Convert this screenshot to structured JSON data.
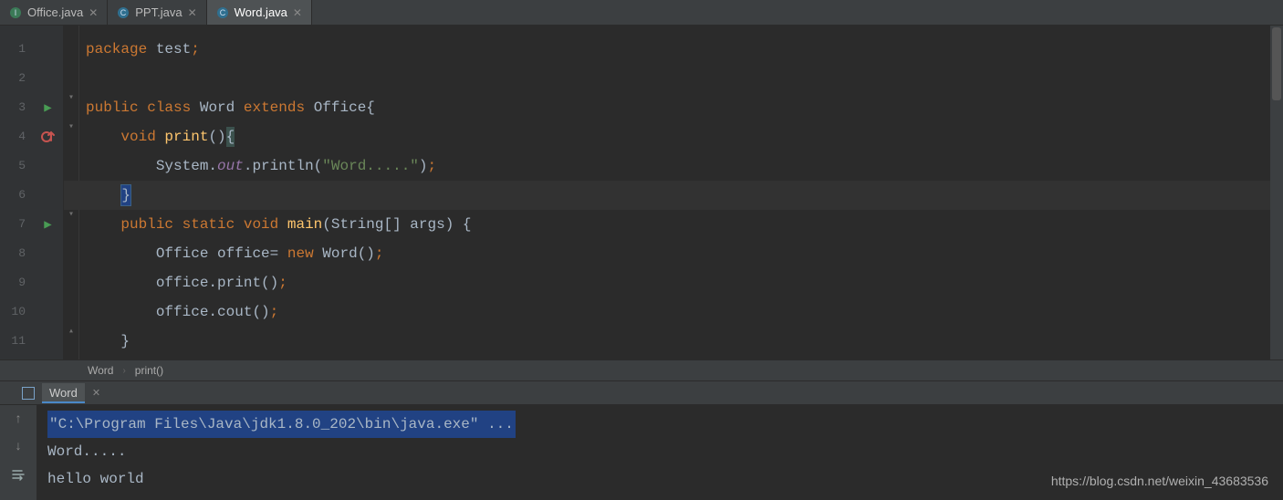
{
  "tabs": [
    {
      "label": "Office.java",
      "active": false,
      "icon": "interface"
    },
    {
      "label": "PPT.java",
      "active": false,
      "icon": "class"
    },
    {
      "label": "Word.java",
      "active": true,
      "icon": "class"
    }
  ],
  "gutter": {
    "line_numbers": [
      "1",
      "2",
      "3",
      "4",
      "5",
      "6",
      "7",
      "8",
      "9",
      "10",
      "11"
    ],
    "run_markers": {
      "line3": "run",
      "line7": "run"
    },
    "override_marker": {
      "line4": "override-up"
    }
  },
  "code": {
    "l1": {
      "kw_package": "package",
      "pkg": "test",
      "semi": ";"
    },
    "l3": {
      "kw_public": "public",
      "kw_class": "class",
      "cls": "Word",
      "kw_extends": "extends",
      "sup": "Office",
      "brace": "{"
    },
    "l4": {
      "kw_void": "void",
      "fn": "print",
      "paren": "()",
      "brace": "{"
    },
    "l5": {
      "sys": "System",
      "dot1": ".",
      "out": "out",
      "dot2": ".",
      "println": "println",
      "lp": "(",
      "str": "\"Word.....\"",
      "rp": ")",
      "semi": ";"
    },
    "l6": {
      "brace": "}"
    },
    "l7": {
      "kw_public": "public",
      "kw_static": "static",
      "kw_void": "void",
      "fn": "main",
      "lp": "(",
      "argt": "String[]",
      "argn": "args",
      "rp": ")",
      "sp": " ",
      "brace": "{"
    },
    "l8": {
      "t": "Office",
      "v": "office",
      "eq": "=",
      "kw_new": "new",
      "ctor": "Word",
      "paren": "()",
      "semi": ";"
    },
    "l9": {
      "v": "office",
      "dot": ".",
      "m": "print",
      "paren": "()",
      "semi": ";"
    },
    "l10": {
      "v": "office",
      "dot": ".",
      "m": "cout",
      "paren": "()",
      "semi": ";"
    },
    "l11": {
      "brace": "}"
    }
  },
  "breadcrumb": {
    "cls": "Word",
    "sep": "›",
    "method": "print()"
  },
  "run_tab": {
    "title": "Word"
  },
  "console": {
    "cmd": "\"C:\\Program Files\\Java\\jdk1.8.0_202\\bin\\java.exe\" ...",
    "out1": "Word.....",
    "out2": "hello world"
  },
  "watermark": "https://blog.csdn.net/weixin_43683536"
}
